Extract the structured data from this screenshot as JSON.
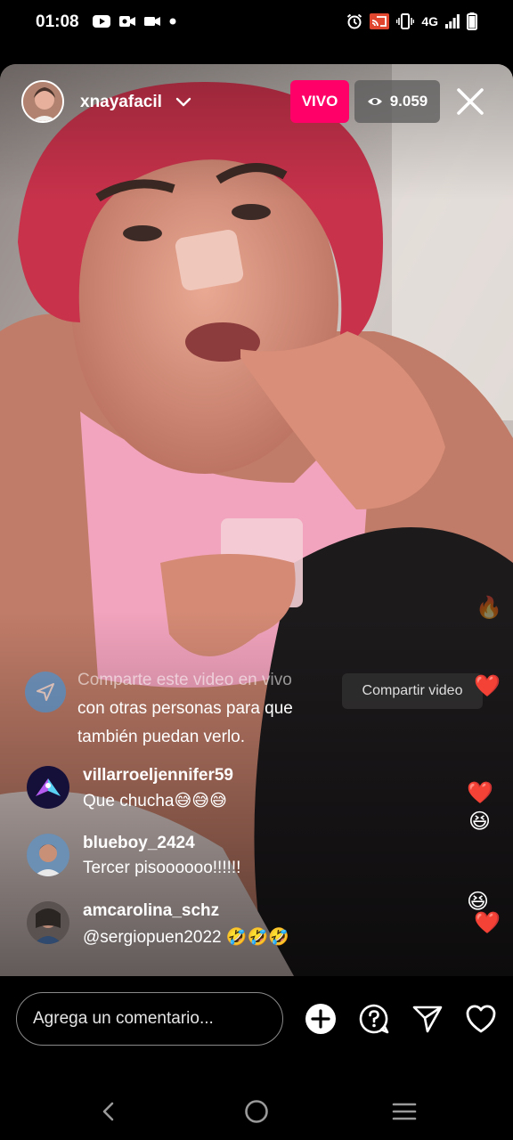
{
  "status_bar": {
    "time": "01:08",
    "network": "4G",
    "icons": [
      "youtube-icon",
      "video-call-icon",
      "video-camera-icon",
      "dot-icon",
      "alarm-icon",
      "cast-icon",
      "vibrate-icon",
      "signal-icon",
      "battery-icon"
    ]
  },
  "live": {
    "host_username": "xnayafacil",
    "live_label": "VIVO",
    "viewer_count": "9.059"
  },
  "share_prompt": {
    "line1": "Comparte este video en vivo",
    "line2": "con otras personas para que",
    "line3": "también puedan verlo.",
    "button_label": "Compartir video"
  },
  "comments": [
    {
      "username": "villarroeljennifer59",
      "text": "Que chucha😅😅😅"
    },
    {
      "username": "blueboy_2424",
      "text": "Tercer pisoooooo!!!!!!"
    },
    {
      "username": "amcarolina_schz",
      "text": "@sergiopuen2022 🤣🤣🤣"
    }
  ],
  "reactions": {
    "fire": "🔥",
    "heart": "❤️",
    "laugh": "😆"
  },
  "bottom_bar": {
    "comment_placeholder": "Agrega un comentario..."
  },
  "colors": {
    "live_badge": "#ff0069",
    "share_icon": "#2f9cf0",
    "background": "#000000"
  }
}
